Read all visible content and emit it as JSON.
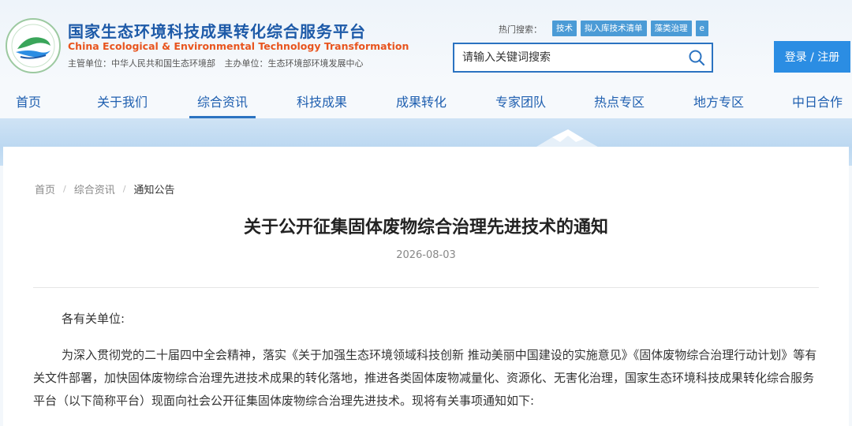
{
  "header": {
    "site_title": "国家生态环境科技成果转化综合服务平台",
    "site_title_en": "China Ecological & Environmental Technology Transformation",
    "sponsor": "主管单位：中华人民共和国生态环境部",
    "organizer": "主办单位：生态环境部环境发展中心",
    "hot_search_label": "热门搜索：",
    "hot_tags": [
      "技术",
      "拟入库技术清单",
      "藻类治理",
      "e"
    ],
    "search_placeholder": "请输入关键词搜索",
    "login_label": "登录 / 注册"
  },
  "nav": {
    "items": [
      "首页",
      "关于我们",
      "综合资讯",
      "科技成果",
      "成果转化",
      "专家团队",
      "热点专区",
      "地方专区",
      "中日合作"
    ],
    "active": "综合资讯"
  },
  "breadcrumb": [
    "首页",
    "综合资讯",
    "通知公告"
  ],
  "article": {
    "title": "关于公开征集固体废物综合治理先进技术的通知",
    "date": "2026-08-03",
    "greeting": "各有关单位:",
    "paragraph": "为深入贯彻党的二十届四中全会精神，落实《关于加强生态环境领域科技创新 推动美丽中国建设的实施意见》《固体废物综合治理行动计划》等有关文件部署，加快固体废物综合治理先进技术成果的转化落地，推进各类固体废物减量化、资源化、无害化治理，国家生态环境科技成果转化综合服务平台（以下简称平台）现面向社会公开征集固体废物综合治理先进技术。现将有关事项通知如下:"
  },
  "colors": {
    "brand_blue": "#1d5aa8",
    "accent_orange": "#e8541e",
    "login_button": "#2b8de3",
    "tag_blue": "#4b9bd6"
  }
}
